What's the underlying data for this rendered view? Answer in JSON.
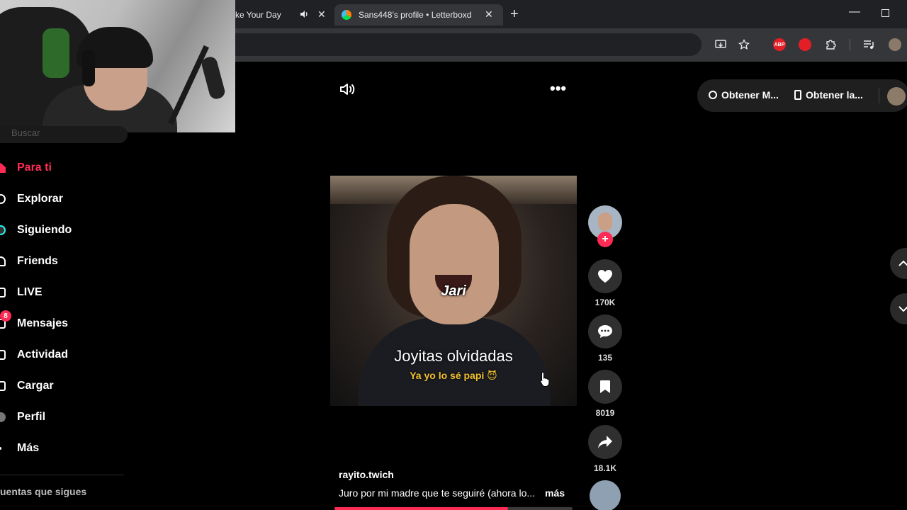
{
  "browser": {
    "tabs": [
      {
        "title": "ke Your Day",
        "audio": true
      },
      {
        "title": "Sans448’s profile • Letterboxd"
      }
    ],
    "new_tab_label": "+",
    "close_glyph": "✕",
    "minimize_glyph": "—"
  },
  "sidebar": {
    "search_placeholder": "Buscar",
    "items": [
      {
        "label": "Para ti",
        "icon": "home-icon",
        "active": true
      },
      {
        "label": "Explorar",
        "icon": "compass-icon"
      },
      {
        "label": "Siguiendo",
        "icon": "following-icon"
      },
      {
        "label": "Friends",
        "icon": "friends-icon"
      },
      {
        "label": "LIVE",
        "icon": "live-icon"
      },
      {
        "label": "Mensajes",
        "icon": "messages-icon",
        "badge": "8"
      },
      {
        "label": "Actividad",
        "icon": "activity-icon"
      },
      {
        "label": "Cargar",
        "icon": "upload-icon"
      },
      {
        "label": "Perfil",
        "icon": "profile-avatar"
      },
      {
        "label": "Más",
        "icon": "more-icon"
      }
    ],
    "following_section_title": "uentas que sigues"
  },
  "topbar": {
    "more_glyph": "•••",
    "get_app_1": "Obtener M...",
    "get_app_2": "Obtener la..."
  },
  "video": {
    "caption_name": "Jari",
    "caption_title": "Joyitas olvidadas",
    "caption_sub": "Ya yo lo sé papi 😈",
    "username": "rayito.twich",
    "description": "Juro por mi madre que te seguiré (ahora lo...",
    "more_label": "más",
    "progress": 0.73
  },
  "actions": {
    "follow_glyph": "+",
    "likes": "170K",
    "comments": "135",
    "saves": "8019",
    "shares": "18.1K"
  },
  "colors": {
    "accent": "#fe2c55",
    "caption_yellow": "#f2c230",
    "background": "#000000"
  }
}
